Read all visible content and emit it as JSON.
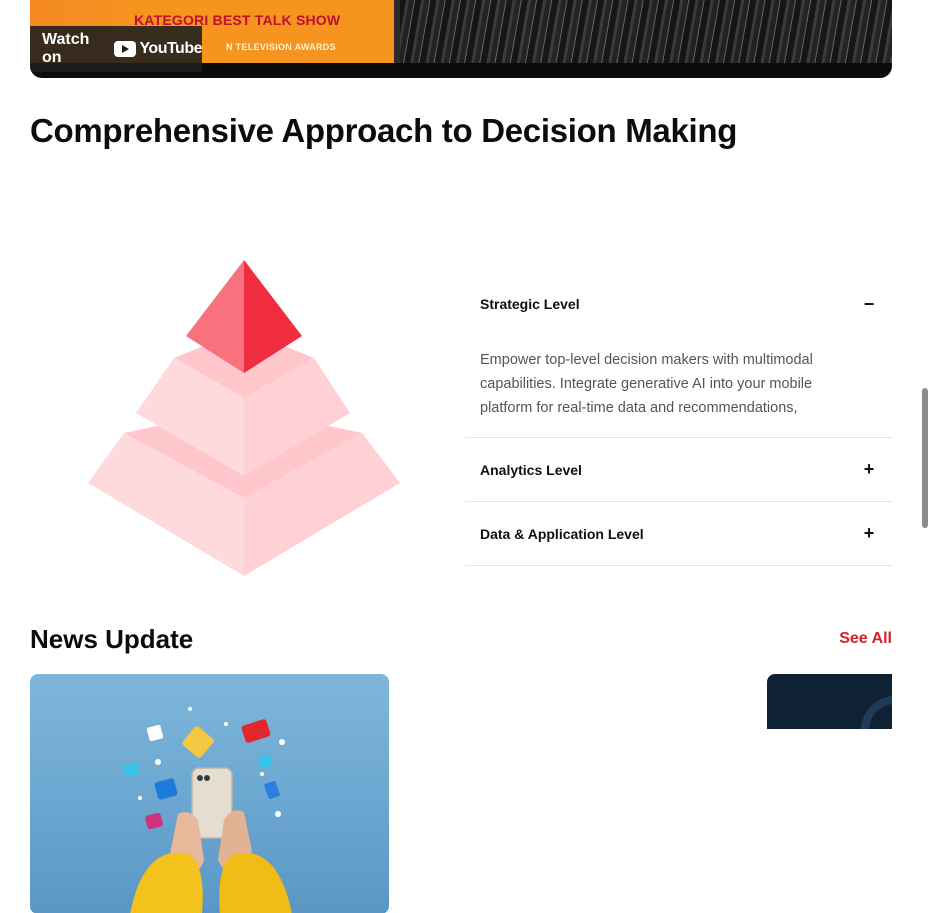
{
  "video": {
    "watch_label": "Watch on",
    "youtube_label": "YouTube",
    "thumbnail_headline": "KATEGORI BEST TALK SHOW",
    "thumbnail_subline": "N TELEVISION AWARDS"
  },
  "section": {
    "title": "Comprehensive Approach to Decision Making"
  },
  "accordion": [
    {
      "title": "Strategic Level",
      "toggle": "−",
      "expanded": true,
      "body": "Empower top-level decision makers with multimodal capabilities. Integrate generative AI into your mobile platform for real-time data and recommendations,"
    },
    {
      "title": "Analytics Level",
      "toggle": "+",
      "expanded": false
    },
    {
      "title": "Data & Application Level",
      "toggle": "+",
      "expanded": false
    }
  ],
  "news": {
    "title": "News Update",
    "see_all": "See All"
  },
  "colors": {
    "accent": "#d3212d",
    "pyramid_top": "#ef2d3f",
    "pyramid_light": "#ffd4d7"
  }
}
